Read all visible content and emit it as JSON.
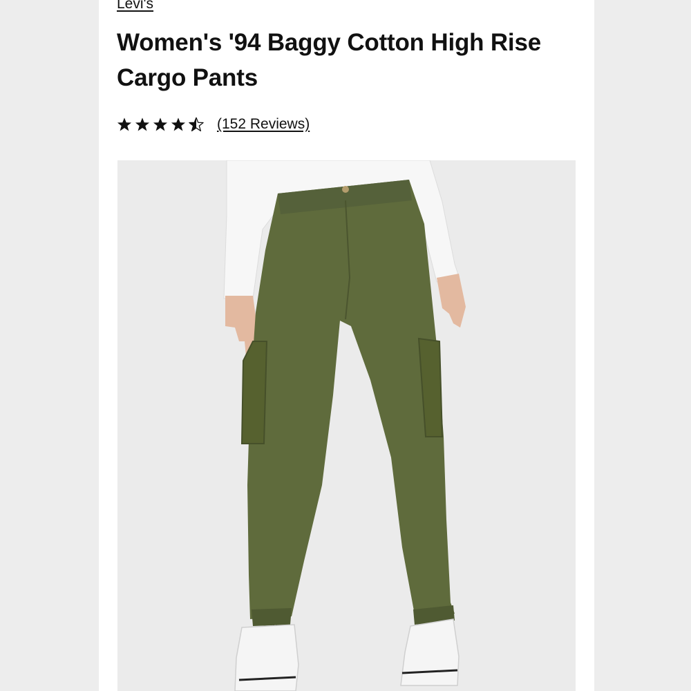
{
  "brand": "Levi's",
  "product": {
    "title": "Women's '94 Baggy Cotton High Rise Cargo Pants"
  },
  "rating": {
    "value": 4.5,
    "max": 5,
    "reviews_label": "(152 Reviews)"
  },
  "image": {
    "alt": "Model wearing olive green baggy cargo pants with white long-sleeve top and white high-top sneakers",
    "pants_color": "#5f6b3c",
    "top_color": "#f7f7f7",
    "background_color": "#ebebeb"
  },
  "colors": {
    "page_bg": "#ffffff",
    "side_bg": "#ededed",
    "text": "#111111"
  }
}
